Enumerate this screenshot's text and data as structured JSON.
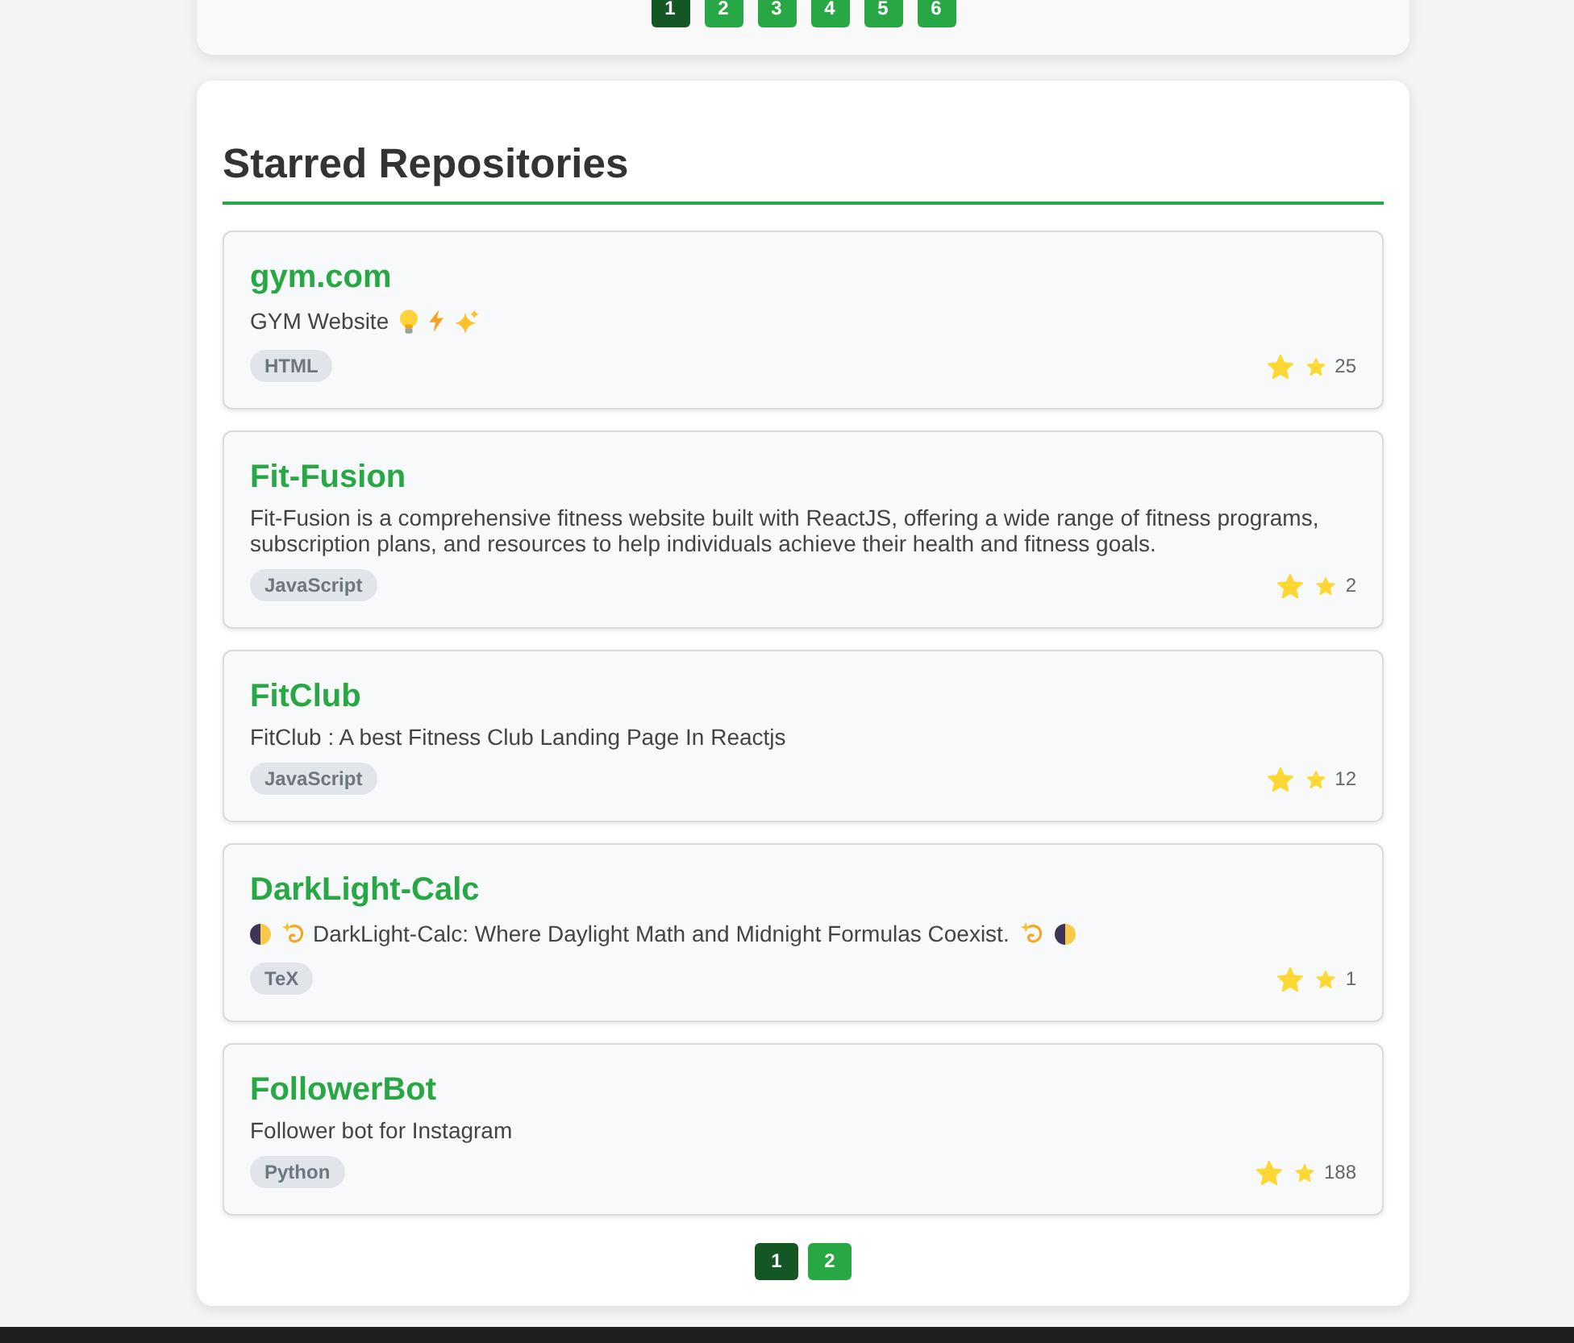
{
  "top_pagination": {
    "pages": [
      {
        "label": "1",
        "selected": true
      },
      {
        "label": "2",
        "selected": false
      },
      {
        "label": "3",
        "selected": false
      },
      {
        "label": "4",
        "selected": false
      },
      {
        "label": "5",
        "selected": false
      },
      {
        "label": "6",
        "selected": false
      }
    ]
  },
  "starred": {
    "title": "Starred Repositories",
    "repos": [
      {
        "name": "gym.com",
        "description": [
          {
            "kind": "text",
            "text": "GYM Website"
          },
          {
            "kind": "bulb"
          },
          {
            "kind": "lightning"
          },
          {
            "kind": "sparkles"
          }
        ],
        "language": "HTML",
        "star_count": "25"
      },
      {
        "name": "Fit-Fusion",
        "description": [
          {
            "kind": "text",
            "text": "Fit-Fusion is a comprehensive fitness website built with ReactJS, offering a wide range of fitness programs, subscription plans, and resources to help individuals achieve their health and fitness goals."
          }
        ],
        "language": "JavaScript",
        "star_count": "2"
      },
      {
        "name": "FitClub",
        "description": [
          {
            "kind": "text",
            "text": "FitClub : A best Fitness Club Landing Page In Reactjs"
          }
        ],
        "language": "JavaScript",
        "star_count": "12"
      },
      {
        "name": "DarkLight-Calc",
        "description": [
          {
            "kind": "half-moon"
          },
          {
            "kind": "dizzy"
          },
          {
            "kind": "text",
            "text": "DarkLight-Calc: Where Daylight Math and Midnight Formulas Coexist."
          },
          {
            "kind": "dizzy"
          },
          {
            "kind": "half-moon"
          }
        ],
        "language": "TeX",
        "star_count": "1"
      },
      {
        "name": "FollowerBot",
        "description": [
          {
            "kind": "text",
            "text": "Follower bot for Instagram"
          }
        ],
        "language": "Python",
        "star_count": "188"
      }
    ],
    "pagination": {
      "pages": [
        {
          "label": "1",
          "selected": true
        },
        {
          "label": "2",
          "selected": false
        }
      ]
    }
  }
}
